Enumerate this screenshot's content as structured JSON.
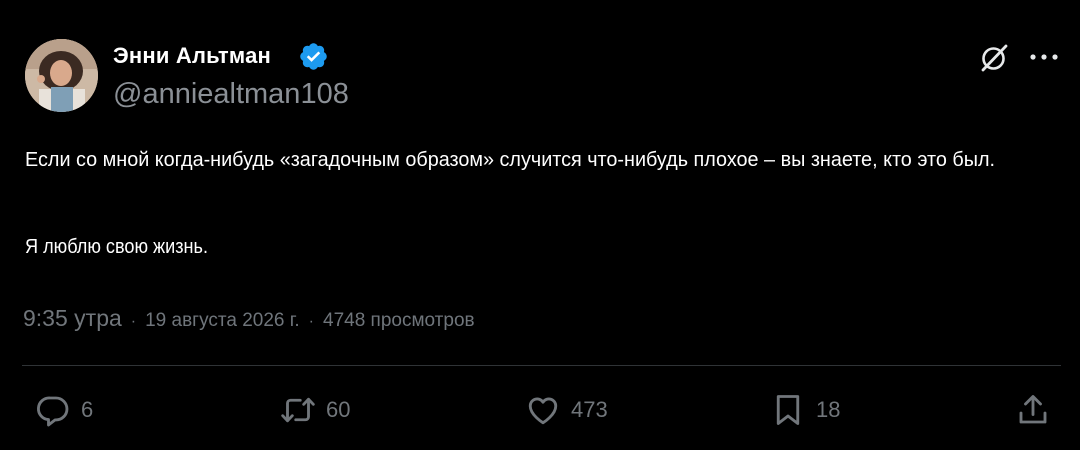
{
  "author": {
    "display_name": "Энни Альтман",
    "handle": "@anniealtman108",
    "verified": true,
    "verified_color": "#1d9bf0"
  },
  "header_icons": [
    "grok-icon",
    "more-icon"
  ],
  "tweet": {
    "lines": [
      "Если со мной когда-нибудь «загадочным образом» случится что-нибудь плохое – вы знаете, кто это был.",
      "Я люблю свою жизнь."
    ]
  },
  "meta": {
    "time": "9:35 утра",
    "date": "19 августа 2026 г.",
    "views": "4748 просмотров",
    "separator": "·"
  },
  "actions": [
    {
      "icon": "reply-icon",
      "count": "6"
    },
    {
      "icon": "retweet-icon",
      "count": "60"
    },
    {
      "icon": "like-icon",
      "count": "473"
    },
    {
      "icon": "bookmark-icon",
      "count": "18"
    },
    {
      "icon": "share-icon",
      "count": ""
    }
  ],
  "colors": {
    "background": "#000000",
    "text": "#ffffff",
    "muted": "#71767b",
    "divider": "#2f3336"
  }
}
